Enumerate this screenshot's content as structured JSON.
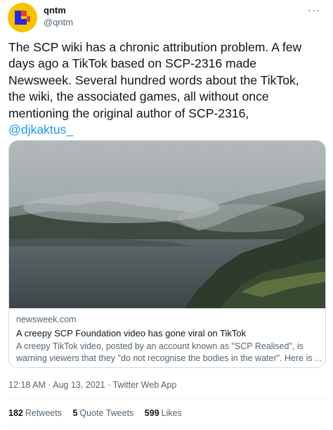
{
  "author": {
    "display_name": "qntm",
    "handle": "@qntm"
  },
  "more_menu": "···",
  "tweet": {
    "lines": [
      "The SCP wiki has a chronic attribution problem. A few",
      "days ago a TikTok based on SCP-2316 made",
      "Newsweek. Several hundred words about the TikTok,",
      "the wiki, the associated games, all without once",
      "mentioning the original author of SCP-2316,"
    ],
    "mention": "@djkaktus_"
  },
  "card": {
    "domain": "newsweek.com",
    "title": "A creepy SCP Foundation video has gone viral on TikTok",
    "description": "A creepy TikTok video, posted by an account known as \"SCP Realised\", is warning viewers that they \"do not recognise the bodies in the water\". Here is ..."
  },
  "meta": {
    "time": "12:18 AM",
    "sep1": " · ",
    "date": "Aug 13, 2021",
    "sep2": " · ",
    "client": "Twitter Web App"
  },
  "stats": {
    "retweets_count": "182",
    "retweets_label": "Retweets",
    "quotes_count": "5",
    "quotes_label": "Quote Tweets",
    "likes_count": "599",
    "likes_label": "Likes"
  },
  "colors": {
    "accent": "#1d9bf0",
    "avatar_bg": "#f5c400"
  }
}
